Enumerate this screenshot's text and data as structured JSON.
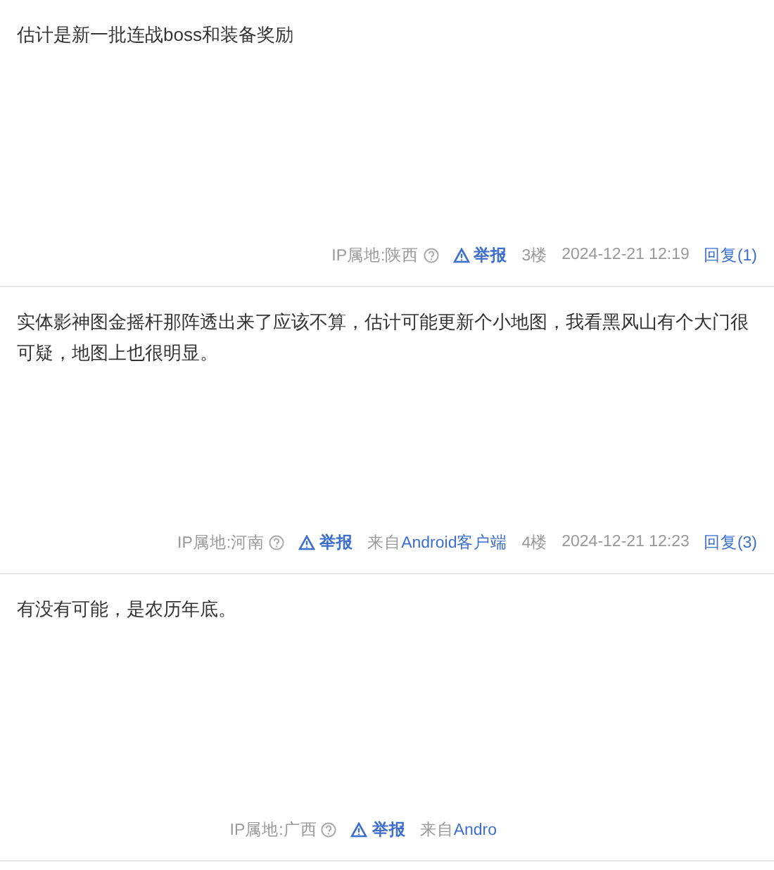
{
  "posts": [
    {
      "content": "估计是新一批连战boss和装备奖励",
      "ip": "IP属地:陕西",
      "report": "举报",
      "floor": "3楼",
      "time": "2024-12-21 12:19",
      "reply": "回复(1)"
    },
    {
      "content": "实体影神图金摇杆那阵透出来了应该不算，估计可能更新个小地图，我看黑风山有个大门很可疑，地图上也很明显。",
      "ip": "IP属地:河南",
      "report": "举报",
      "source_prefix": "来自",
      "source_link": "Android客户端",
      "floor": "4楼",
      "time": "2024-12-21 12:23",
      "reply": "回复(3)"
    },
    {
      "content": "有没有可能，是农历年底。",
      "ip": "IP属地:广西",
      "report": "举报",
      "source_prefix": "来自",
      "source_link": "Andro"
    }
  ]
}
